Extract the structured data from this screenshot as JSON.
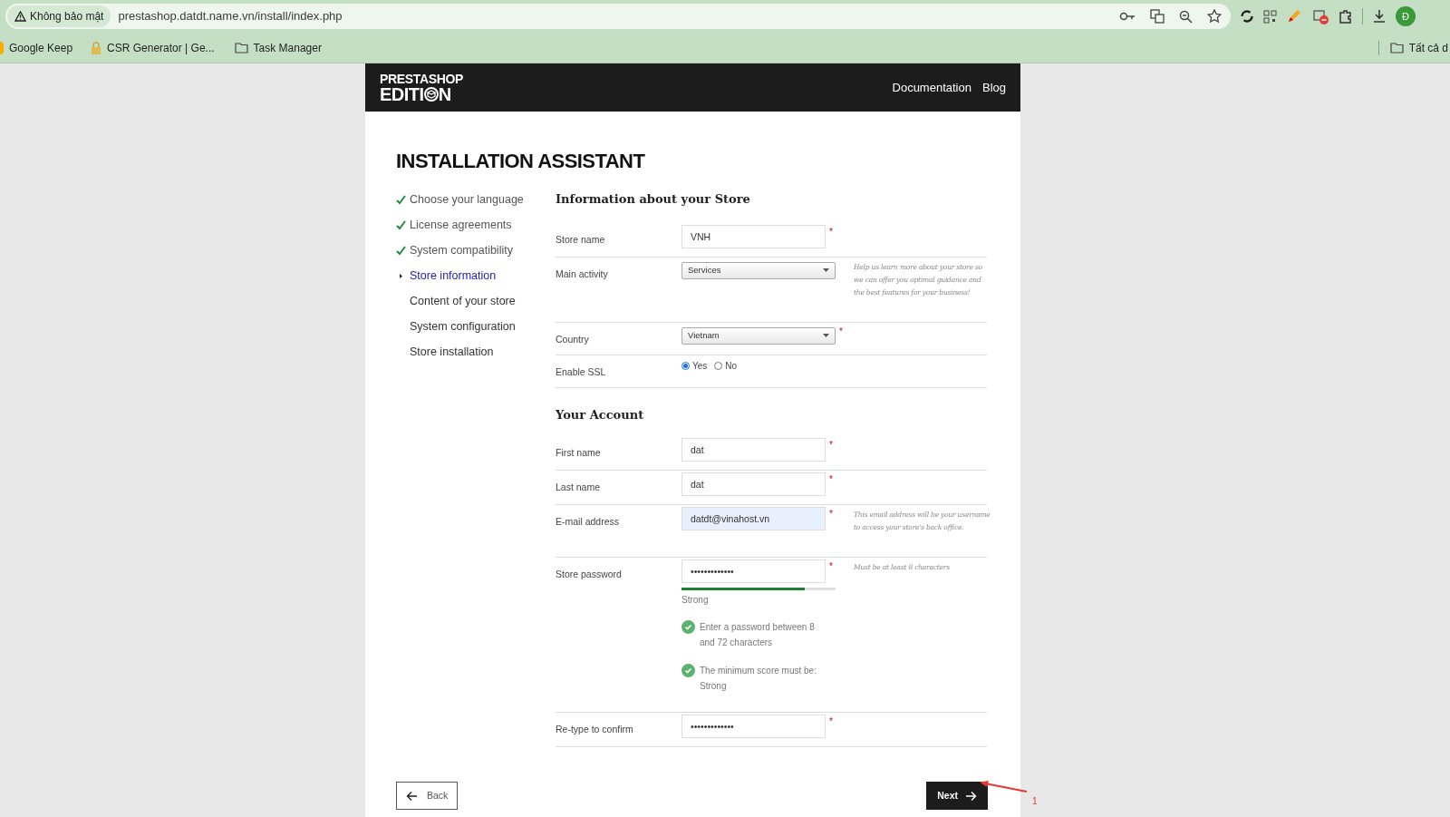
{
  "browser": {
    "security": "Không bảo mật",
    "url": "prestashop.datdt.name.vn/install/index.php",
    "avatar": "Đ",
    "bookmarks": [
      {
        "label": "Google Keep",
        "kind": "keep"
      },
      {
        "label": "CSR Generator | Ge...",
        "kind": "lock"
      },
      {
        "label": "Task Manager",
        "kind": "folder"
      }
    ],
    "all_bookmarks": "Tất cả d"
  },
  "header": {
    "logo_top": "PRESTASHOP",
    "logo_bottom": "EDITI",
    "logo_end": "N",
    "links": [
      "Documentation",
      "Blog"
    ]
  },
  "title": "INSTALLATION ASSISTANT",
  "steps": [
    {
      "label": "Choose your language",
      "checked": true,
      "selected": false
    },
    {
      "label": "License agreements",
      "checked": true,
      "selected": false
    },
    {
      "label": "System compatibility",
      "checked": true,
      "selected": false
    },
    {
      "label": "Store information",
      "checked": false,
      "selected": true
    },
    {
      "label": "Content of your store",
      "checked": false,
      "selected": false
    },
    {
      "label": "System configuration",
      "checked": false,
      "selected": false
    },
    {
      "label": "Store installation",
      "checked": false,
      "selected": false
    }
  ],
  "sections": [
    {
      "heading": "Information about your Store",
      "rows": [
        {
          "kind": "input",
          "label": "Store name",
          "value": "VNH",
          "required_mark": "*",
          "autofilled": false
        },
        {
          "kind": "select",
          "label": "Main activity",
          "value": "Services",
          "help": "Help us learn more about your store so we can offer you optimal guidance and the best features for your business!"
        },
        {
          "kind": "select",
          "label": "Country",
          "value": "Vietnam",
          "required_mark": "*"
        },
        {
          "kind": "radio",
          "label": "Enable SSL",
          "options": [
            {
              "label": "Yes",
              "selected": true
            },
            {
              "label": "No",
              "selected": false
            }
          ]
        }
      ]
    },
    {
      "heading": "Your Account",
      "rows": [
        {
          "kind": "input",
          "label": "First name",
          "value": "dat",
          "required_mark": "*",
          "autofilled": false
        },
        {
          "kind": "input",
          "label": "Last name",
          "value": "dat",
          "required_mark": "*",
          "autofilled": false
        },
        {
          "kind": "input",
          "label": "E-mail address",
          "value": "datdt@vinahost.vn",
          "required_mark": "*",
          "autofilled": true,
          "help": "This email address will be your username to access your store's back office."
        },
        {
          "kind": "password",
          "label": "Store password",
          "value": "•••••••••••••",
          "required_mark": "*",
          "help": "Must be at least 8 characters",
          "level": 0.8,
          "strength": "Strong",
          "rules": [
            {
              "text": "Enter a password between 8 and 72 characters",
              "checked": true
            },
            {
              "text": "The minimum score must be: Strong",
              "checked": true
            }
          ]
        },
        {
          "kind": "input",
          "label": "Re-type to confirm",
          "value": "•••••••••••••",
          "required_mark": "*",
          "autofilled": false
        }
      ]
    }
  ],
  "buttons": {
    "back": "Back",
    "next": "Next"
  },
  "annotation": {
    "label": "1"
  }
}
